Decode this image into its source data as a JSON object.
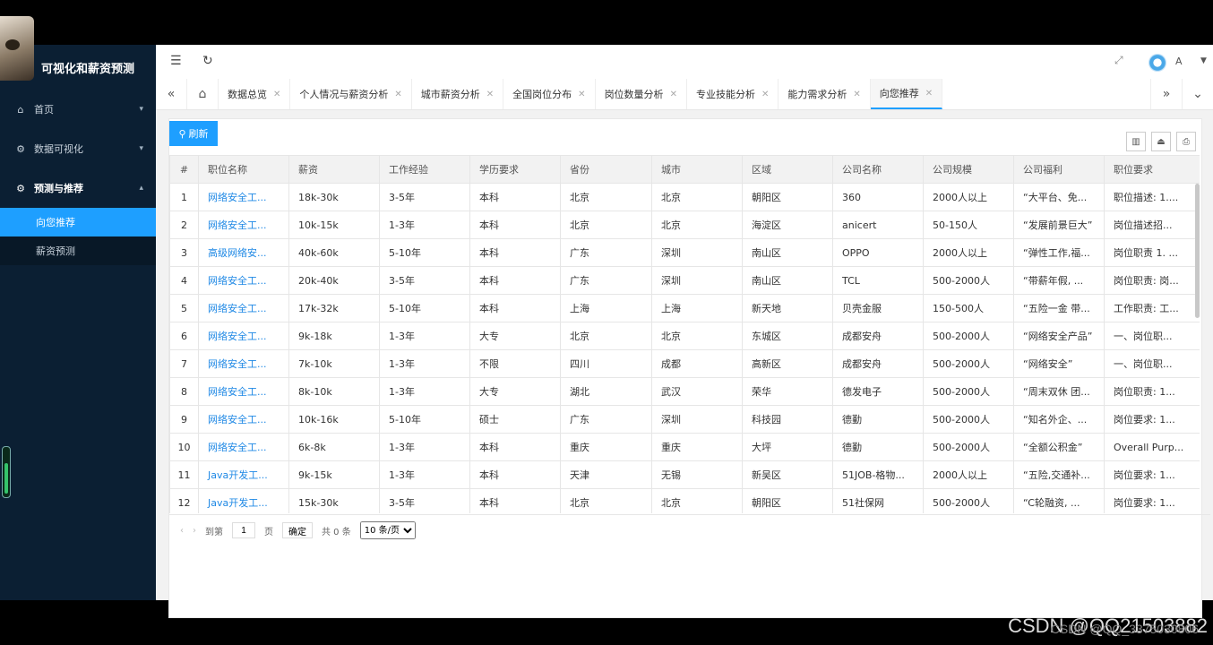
{
  "app": {
    "title": "可视化和薪资预测"
  },
  "sidebar": {
    "items": [
      {
        "label": "首页",
        "icon": "home-icon"
      },
      {
        "label": "数据可视化",
        "icon": "gear-icon"
      },
      {
        "label": "预测与推荐",
        "icon": "gear-icon"
      }
    ],
    "sub_items": [
      {
        "label": "向您推荐",
        "active": true
      },
      {
        "label": "薪资预测",
        "active": false
      }
    ]
  },
  "topbar": {
    "user": "A"
  },
  "tabs": [
    {
      "label": "数据总览"
    },
    {
      "label": "个人情况与薪资分析"
    },
    {
      "label": "城市薪资分析"
    },
    {
      "label": "全国岗位分布"
    },
    {
      "label": "岗位数量分析"
    },
    {
      "label": "专业技能分析"
    },
    {
      "label": "能力需求分析"
    },
    {
      "label": "向您推荐",
      "active": true
    }
  ],
  "toolbar": {
    "refresh_label": "刷新"
  },
  "table": {
    "headers": [
      "#",
      "职位名称",
      "薪资",
      "工作经验",
      "学历要求",
      "省份",
      "城市",
      "区域",
      "公司名称",
      "公司规模",
      "公司福利",
      "职位要求"
    ],
    "rows": [
      [
        "1",
        "网络安全工...",
        "18k-30k",
        "3-5年",
        "本科",
        "北京",
        "北京",
        "朝阳区",
        "360",
        "2000人以上",
        "“大平台、免...",
        "职位描述: 1...."
      ],
      [
        "2",
        "网络安全工...",
        "10k-15k",
        "1-3年",
        "本科",
        "北京",
        "北京",
        "海淀区",
        "anicert",
        "50-150人",
        "“发展前景巨大”",
        "岗位描述招..."
      ],
      [
        "3",
        "高级网络安...",
        "40k-60k",
        "5-10年",
        "本科",
        "广东",
        "深圳",
        "南山区",
        "OPPO",
        "2000人以上",
        "“弹性工作,福...",
        "岗位职责 1. ..."
      ],
      [
        "4",
        "网络安全工...",
        "20k-40k",
        "3-5年",
        "本科",
        "广东",
        "深圳",
        "南山区",
        "TCL",
        "500-2000人",
        "“带薪年假, ...",
        "岗位职责: 岗..."
      ],
      [
        "5",
        "网络安全工...",
        "17k-32k",
        "5-10年",
        "本科",
        "上海",
        "上海",
        "新天地",
        "贝壳金服",
        "150-500人",
        "“五险一金 带...",
        "工作职责: 工..."
      ],
      [
        "6",
        "网络安全工...",
        "9k-18k",
        "1-3年",
        "大专",
        "北京",
        "北京",
        "东城区",
        "成都安舟",
        "500-2000人",
        "“网络安全产品”",
        "一、岗位职..."
      ],
      [
        "7",
        "网络安全工...",
        "7k-10k",
        "1-3年",
        "不限",
        "四川",
        "成都",
        "高新区",
        "成都安舟",
        "500-2000人",
        "“网络安全”",
        "一、岗位职..."
      ],
      [
        "8",
        "网络安全工...",
        "8k-10k",
        "1-3年",
        "大专",
        "湖北",
        "武汉",
        "荣华",
        "德发电子",
        "500-2000人",
        "“周末双休 团...",
        "岗位职责: 1..."
      ],
      [
        "9",
        "网络安全工...",
        "10k-16k",
        "5-10年",
        "硕士",
        "广东",
        "深圳",
        "科技园",
        "德勤",
        "500-2000人",
        "“知名外企、...",
        "岗位要求: 1..."
      ],
      [
        "10",
        "网络安全工...",
        "6k-8k",
        "1-3年",
        "本科",
        "重庆",
        "重庆",
        "大坪",
        "德勤",
        "500-2000人",
        "“全额公积金”",
        "Overall Purp..."
      ],
      [
        "11",
        "Java开发工...",
        "9k-15k",
        "1-3年",
        "本科",
        "天津",
        "无锡",
        "新吴区",
        "51JOB-格物...",
        "2000人以上",
        "“五险,交通补...",
        "岗位要求: 1..."
      ],
      [
        "12",
        "Java开发工...",
        "15k-30k",
        "3-5年",
        "本科",
        "北京",
        "北京",
        "朝阳区",
        "51社保网",
        "500-2000人",
        "“C轮融资, ...",
        "岗位要求: 1..."
      ]
    ]
  },
  "pager": {
    "goto_label": "到第",
    "page_value": "1",
    "page_unit": "页",
    "confirm_label": "确定",
    "total_label": "共 0 条",
    "page_size": "10 条/页"
  },
  "watermark": "CSDN @QQ21503882",
  "watermark_overlay": "CSDN @QQ_3375030806"
}
